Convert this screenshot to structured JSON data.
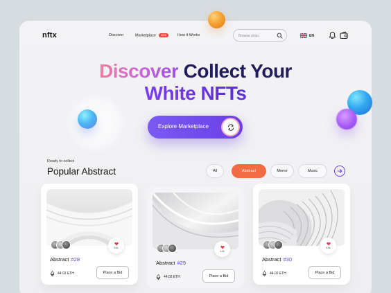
{
  "header": {
    "logo": "nftx",
    "nav": [
      {
        "label": "Discover"
      },
      {
        "label": "Marketplace",
        "badge": "NEW"
      },
      {
        "label": "How it Works"
      }
    ],
    "search_placeholder": "Browse shop",
    "language": "EN"
  },
  "hero": {
    "title_part1": "Discover",
    "title_part2": "Collect Your",
    "title_line2": "White NFTs",
    "cta_label": "Explore Marketplace"
  },
  "section": {
    "kicker": "Ready to collect",
    "title": "Popular Abstract",
    "filters": [
      "All",
      "Abstract",
      "Meme",
      "Music"
    ],
    "active_filter": "Abstract"
  },
  "cards": [
    {
      "title": "Abstract",
      "number": "#28",
      "price": "44.02 ETH",
      "likes": "5.5k",
      "bid_label": "Place a Bid"
    },
    {
      "title": "Abstract",
      "number": "#29",
      "price": "44.02 ETH",
      "likes": "5.5k",
      "bid_label": "Place a Bid"
    },
    {
      "title": "Abstract",
      "number": "#30",
      "price": "44.02 ETH",
      "likes": "5.5k",
      "bid_label": "Place a Bid"
    }
  ],
  "colors": {
    "accent_purple": "#6a3fe6",
    "accent_orange": "#f36b43",
    "heading_dark": "#221b5c",
    "badge_red": "#f0443a"
  }
}
